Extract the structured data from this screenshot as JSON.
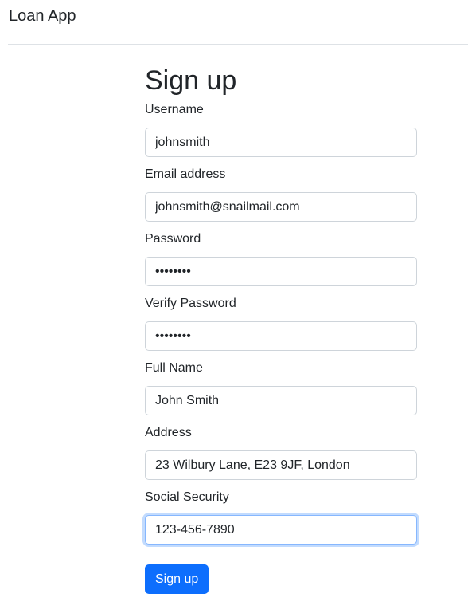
{
  "app": {
    "title": "Loan App"
  },
  "page": {
    "title": "Sign up"
  },
  "form": {
    "username": {
      "label": "Username",
      "value": "johnsmith"
    },
    "email": {
      "label": "Email address",
      "value": "johnsmith@snailmail.com"
    },
    "password": {
      "label": "Password",
      "value": "••••••••"
    },
    "verify_password": {
      "label": "Verify Password",
      "value": "••••••••"
    },
    "full_name": {
      "label": "Full Name",
      "value": "John Smith"
    },
    "address": {
      "label": "Address",
      "value": "23 Wilbury Lane, E23 9JF, London"
    },
    "social_security": {
      "label": "Social Security",
      "value": "123-456-7890"
    },
    "submit_label": "Sign up"
  },
  "colors": {
    "primary": "#0d6efd",
    "focus_border": "#86b7fe",
    "input_border": "#ced4da",
    "text": "#212529"
  }
}
